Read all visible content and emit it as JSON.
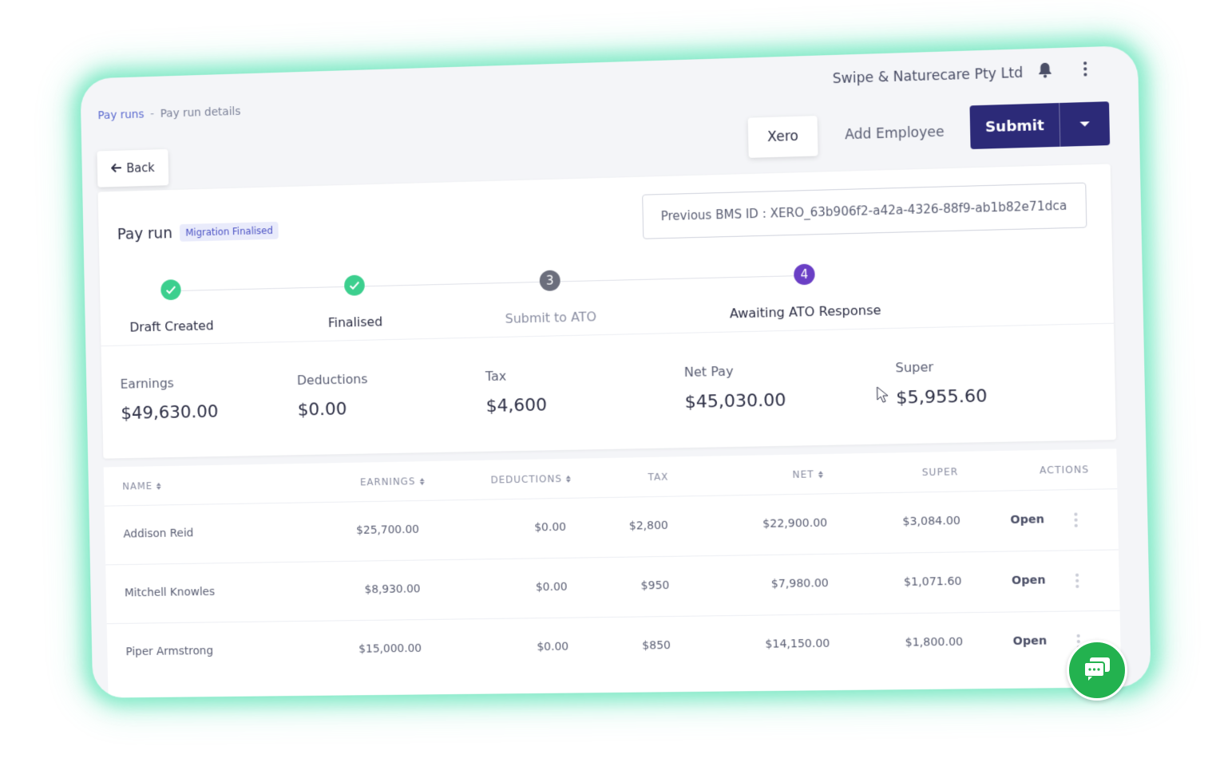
{
  "breadcrumb": {
    "link": "Pay runs",
    "separator": "-",
    "current": "Pay run details"
  },
  "header": {
    "company": "Swipe & Naturecare Pty Ltd",
    "bell_icon": "bell-icon",
    "menu_icon": "kebab-icon"
  },
  "toolbar": {
    "back_label": "Back",
    "xero_label": "Xero",
    "add_employee_label": "Add Employee",
    "submit_label": "Submit"
  },
  "payrun": {
    "title": "Pay run",
    "badge": "Migration Finalised",
    "previous_bms": "Previous BMS ID : XERO_63b906f2-a42a-4326-88f9-ab1b82e71dca"
  },
  "steps": [
    {
      "label": "Draft Created",
      "state": "done"
    },
    {
      "label": "Finalised",
      "state": "done"
    },
    {
      "label": "Submit to ATO",
      "number": "3",
      "state": "pending"
    },
    {
      "label": "Awaiting ATO Response",
      "number": "4",
      "state": "active"
    }
  ],
  "summary": {
    "earnings_label": "Earnings",
    "earnings": "$49,630.00",
    "deductions_label": "Deductions",
    "deductions": "$0.00",
    "tax_label": "Tax",
    "tax": "$4,600",
    "net_label": "Net Pay",
    "net": "$45,030.00",
    "super_label": "Super",
    "super": "$5,955.60"
  },
  "table": {
    "headers": {
      "name": "NAME",
      "earnings": "EARNINGS",
      "deductions": "DEDUCTIONS",
      "tax": "TAX",
      "net": "NET",
      "super": "SUPER",
      "actions": "ACTIONS"
    },
    "rows": [
      {
        "name": "Addison Reid",
        "earnings": "$25,700.00",
        "deductions": "$0.00",
        "tax": "$2,800",
        "net": "$22,900.00",
        "super": "$3,084.00",
        "action": "Open"
      },
      {
        "name": "Mitchell Knowles",
        "earnings": "$8,930.00",
        "deductions": "$0.00",
        "tax": "$950",
        "net": "$7,980.00",
        "super": "$1,071.60",
        "action": "Open"
      },
      {
        "name": "Piper Armstrong",
        "earnings": "$15,000.00",
        "deductions": "$0.00",
        "tax": "$850",
        "net": "$14,150.00",
        "super": "$1,800.00",
        "action": "Open"
      }
    ]
  },
  "colors": {
    "accent": "#2c2a78",
    "success": "#3ccf8e",
    "active_step": "#6a3fc5",
    "glow": "#40deaa",
    "chat": "#23b24f"
  }
}
